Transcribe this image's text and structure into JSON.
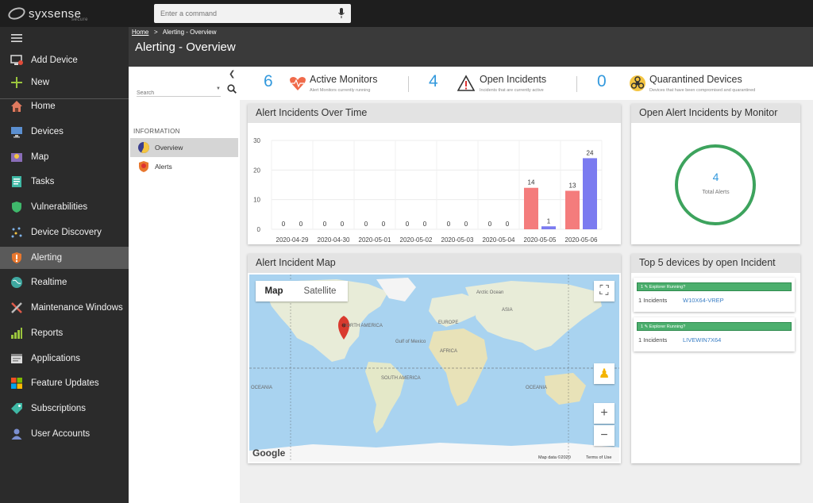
{
  "app": {
    "logo_text": "syxsense",
    "logo_sub": "secure"
  },
  "command": {
    "placeholder": "Enter a command"
  },
  "sidebar": {
    "items": [
      {
        "label": "Add Device"
      },
      {
        "label": "New"
      },
      {
        "label": "Home"
      },
      {
        "label": "Devices"
      },
      {
        "label": "Map"
      },
      {
        "label": "Tasks"
      },
      {
        "label": "Vulnerabilities"
      },
      {
        "label": "Device Discovery"
      },
      {
        "label": "Alerting"
      },
      {
        "label": "Realtime"
      },
      {
        "label": "Maintenance Windows"
      },
      {
        "label": "Reports"
      },
      {
        "label": "Applications"
      },
      {
        "label": "Feature Updates"
      },
      {
        "label": "Subscriptions"
      },
      {
        "label": "User Accounts"
      }
    ]
  },
  "header": {
    "breadcrumb_home": "Home",
    "breadcrumb_sep": ">",
    "breadcrumb_current": "Alerting - Overview",
    "title": "Alerting - Overview"
  },
  "left_panel": {
    "search_placeholder": "Search",
    "section": "INFORMATION",
    "items": [
      {
        "label": "Overview"
      },
      {
        "label": "Alerts"
      }
    ]
  },
  "stats": [
    {
      "value": "6",
      "title": "Active Monitors",
      "desc": "Alert Monitors currently running"
    },
    {
      "value": "4",
      "title": "Open Incidents",
      "desc": "Incidents that are currently active"
    },
    {
      "value": "0",
      "title": "Quarantined Devices",
      "desc": "Devices that have been compromised and quarantined"
    }
  ],
  "alert_chart_title": "Alert Incidents Over Time",
  "chart_data": {
    "type": "bar",
    "categories": [
      "2020-04-29",
      "2020-04-30",
      "2020-05-01",
      "2020-05-02",
      "2020-05-03",
      "2020-05-04",
      "2020-05-05",
      "2020-05-06"
    ],
    "series": [
      {
        "values": [
          0,
          0,
          0,
          0,
          0,
          0,
          14,
          13
        ],
        "color": "#f47c7c"
      },
      {
        "values": [
          0,
          0,
          0,
          0,
          0,
          0,
          1,
          24
        ],
        "color": "#7b7bf0"
      }
    ],
    "yticks": [
      0,
      10,
      20,
      30
    ],
    "ylim": [
      0,
      30
    ]
  },
  "donut": {
    "title": "Open Alert Incidents by Monitor",
    "value": "4",
    "label": "Total Alerts",
    "color": "#3da35d"
  },
  "map": {
    "title": "Alert Incident Map",
    "tab_map": "Map",
    "tab_satellite": "Satellite",
    "labels": [
      "NORTH AMERICA",
      "SOUTH AMERICA",
      "EUROPE",
      "AFRICA",
      "ASIA",
      "OCEANIA",
      "OCEANIA"
    ],
    "small_labels": [
      "Gulf of Mexico",
      "Arctic Ocean"
    ],
    "google": "Google",
    "map_data": "Map data ©2020",
    "terms": "Terms of Use"
  },
  "top_devices": {
    "title": "Top 5 devices by open Incident",
    "items": [
      {
        "bar": "1 ✎ Explorer Running?",
        "count": "1 Incidents",
        "name": "W10X64-VREP"
      },
      {
        "bar": "1 ✎ Explorer Running?",
        "count": "1 Incidents",
        "name": "LIVEWIN7X64"
      }
    ]
  },
  "colors": {
    "accent": "#3399dd",
    "sidebar": "#2b2b2b",
    "active": "#5a5a5a"
  }
}
